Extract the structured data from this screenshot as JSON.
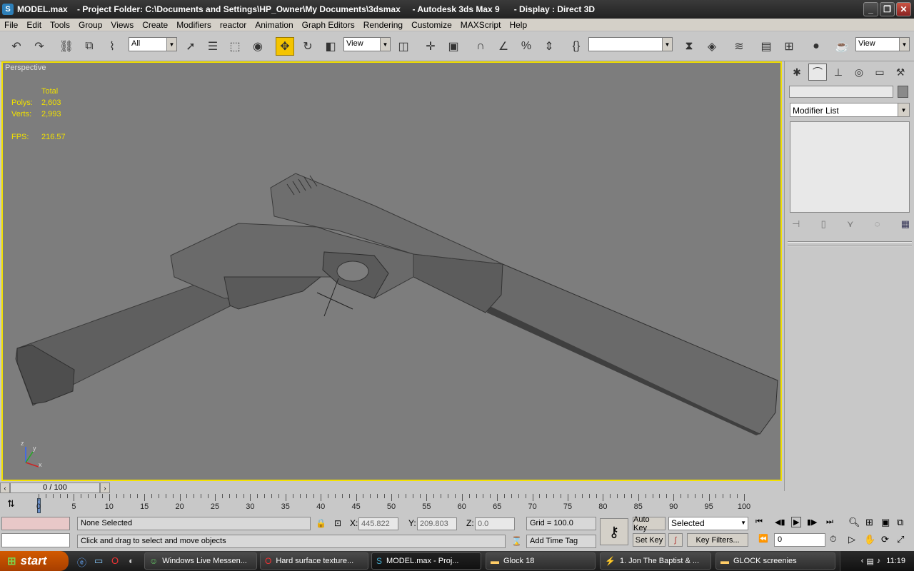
{
  "window": {
    "title": "MODEL.max    - Project Folder: C:\\Documents and Settings\\HP_Owner\\My Documents\\3dsmax     - Autodesk 3ds Max 9      - Display : Direct 3D"
  },
  "menu": [
    "File",
    "Edit",
    "Tools",
    "Group",
    "Views",
    "Create",
    "Modifiers",
    "reactor",
    "Animation",
    "Graph Editors",
    "Rendering",
    "Customize",
    "MAXScript",
    "Help"
  ],
  "toolbar": {
    "selection_filter": "All",
    "ref_coord": "View",
    "named_selection": "",
    "view_right": "View"
  },
  "viewport": {
    "label": "Perspective",
    "stats_header": "Total",
    "polys_label": "Polys:",
    "polys_value": "2,603",
    "verts_label": "Verts:",
    "verts_value": "2,993",
    "fps_label": "FPS:",
    "fps_value": "216.57",
    "axis_z": "z",
    "axis_y": "y",
    "axis_x": "x"
  },
  "command_panel": {
    "modifier_list": "Modifier List"
  },
  "timeline": {
    "slider": "0 / 100",
    "ticks": [
      "0",
      "5",
      "10",
      "15",
      "20",
      "25",
      "30",
      "35",
      "40",
      "45",
      "50",
      "55",
      "60",
      "65",
      "70",
      "75",
      "80",
      "85",
      "90",
      "95",
      "100"
    ]
  },
  "status": {
    "selection": "None Selected",
    "prompt": "Click and drag to select and move objects",
    "x_label": "X:",
    "x_value": "445.822",
    "y_label": "Y:",
    "y_value": "209.803",
    "z_label": "Z:",
    "z_value": "0.0",
    "grid": "Grid = 100.0",
    "add_time_tag": "Add Time Tag",
    "auto_key": "Auto Key",
    "set_key": "Set Key",
    "key_mode": "Selected",
    "key_filters": "Key Filters...",
    "frame": "0"
  },
  "taskbar": {
    "start": "start",
    "tasks": [
      "Windows Live Messen...",
      "Hard surface texture...",
      "MODEL.max     - Proj...",
      "Glock 18",
      "1. Jon The Baptist & ...",
      "GLOCK screenies"
    ],
    "clock": "11:19"
  },
  "colors": {
    "viewport_border": "#f2e000",
    "viewport_bg": "#7d7d7d",
    "stats_text": "#f0e000",
    "active_tool": "#f4c400"
  }
}
